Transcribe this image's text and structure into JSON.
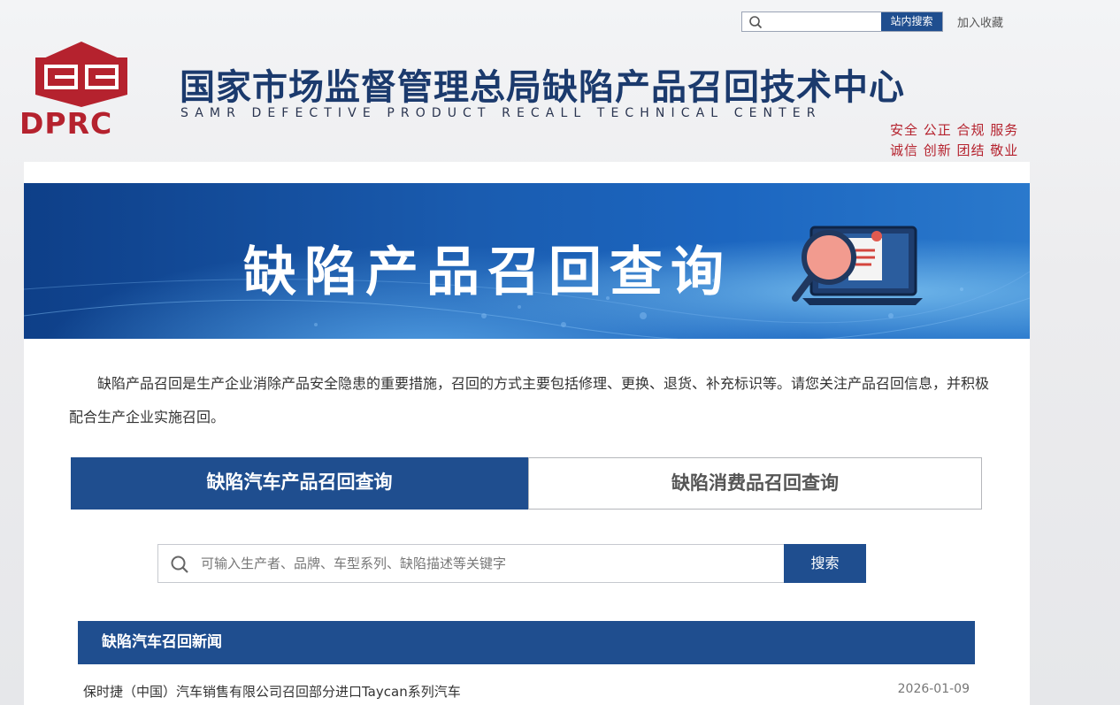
{
  "header": {
    "search_button": "站内搜索",
    "favorite": "加入收藏",
    "logo_text": "DPRC",
    "title": "国家市场监督管理总局缺陷产品召回技术中心",
    "subtitle": "SAMR DEFECTIVE PRODUCT RECALL TECHNICAL CENTER",
    "motto_line1": "安全 公正 合规 服务",
    "motto_line2": "诚信 创新 团结 敬业"
  },
  "banner": {
    "title": "缺陷产品召回查询"
  },
  "intro": "缺陷产品召回是生产企业消除产品安全隐患的重要措施，召回的方式主要包括修理、更换、退货、补充标识等。请您关注产品召回信息，并积极配合生产企业实施召回。",
  "tabs": [
    {
      "label": "缺陷汽车产品召回查询",
      "active": true
    },
    {
      "label": "缺陷消费品召回查询",
      "active": false
    }
  ],
  "search": {
    "placeholder": "可输入生产者、品牌、车型系列、缺陷描述等关键字",
    "button": "搜索"
  },
  "news": {
    "header": "缺陷汽车召回新闻",
    "items": [
      {
        "title": "保时捷（中国）汽车销售有限公司召回部分进口Taycan系列汽车",
        "date": "2026-01-09"
      }
    ]
  },
  "colors": {
    "brand_blue": "#1f4e8f",
    "title_navy": "#1b3a6d",
    "accent_red": "#b5222e"
  }
}
